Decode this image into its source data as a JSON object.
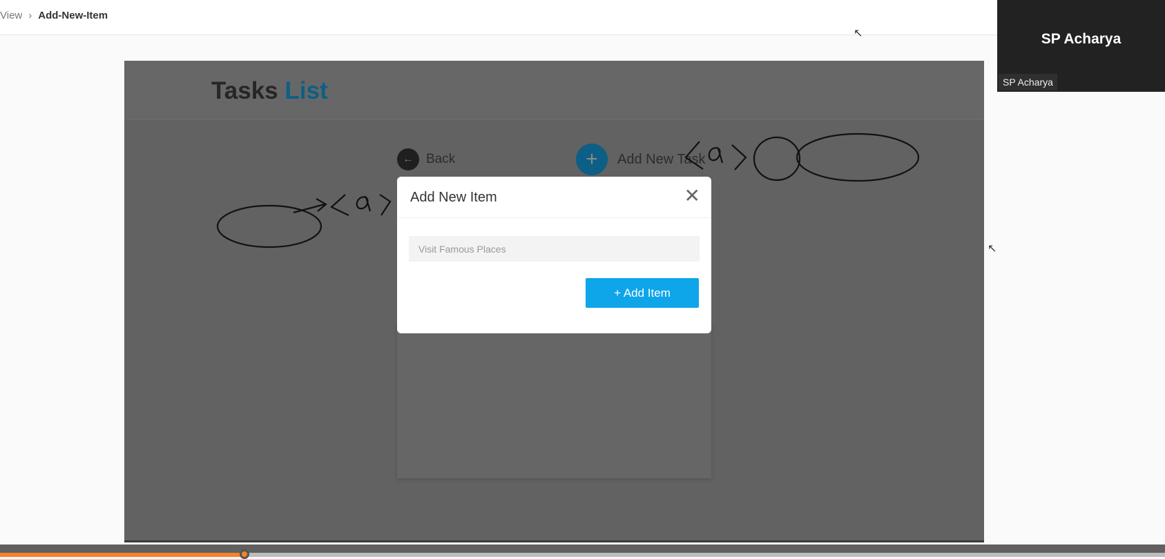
{
  "breadcrumb": {
    "prev": "View",
    "current": "Add-New-Item"
  },
  "app": {
    "title_part1": "Tasks",
    "title_part2": "List",
    "back_label": "Back",
    "back_icon": "arrow-left-icon",
    "add_task_label": "Add New Task",
    "add_task_icon": "plus-icon"
  },
  "modal": {
    "title": "Add New Item",
    "close_icon": "close-icon",
    "input_value": "Visit Famous Places",
    "add_button": "+ Add Item"
  },
  "video": {
    "name": "SP Acharya",
    "label": "SP Acharya"
  },
  "player": {
    "progress_percent": 21
  },
  "colors": {
    "accent": "#0ea5e9",
    "title_accent": "#0d5f86",
    "progress": "#f5822a"
  }
}
